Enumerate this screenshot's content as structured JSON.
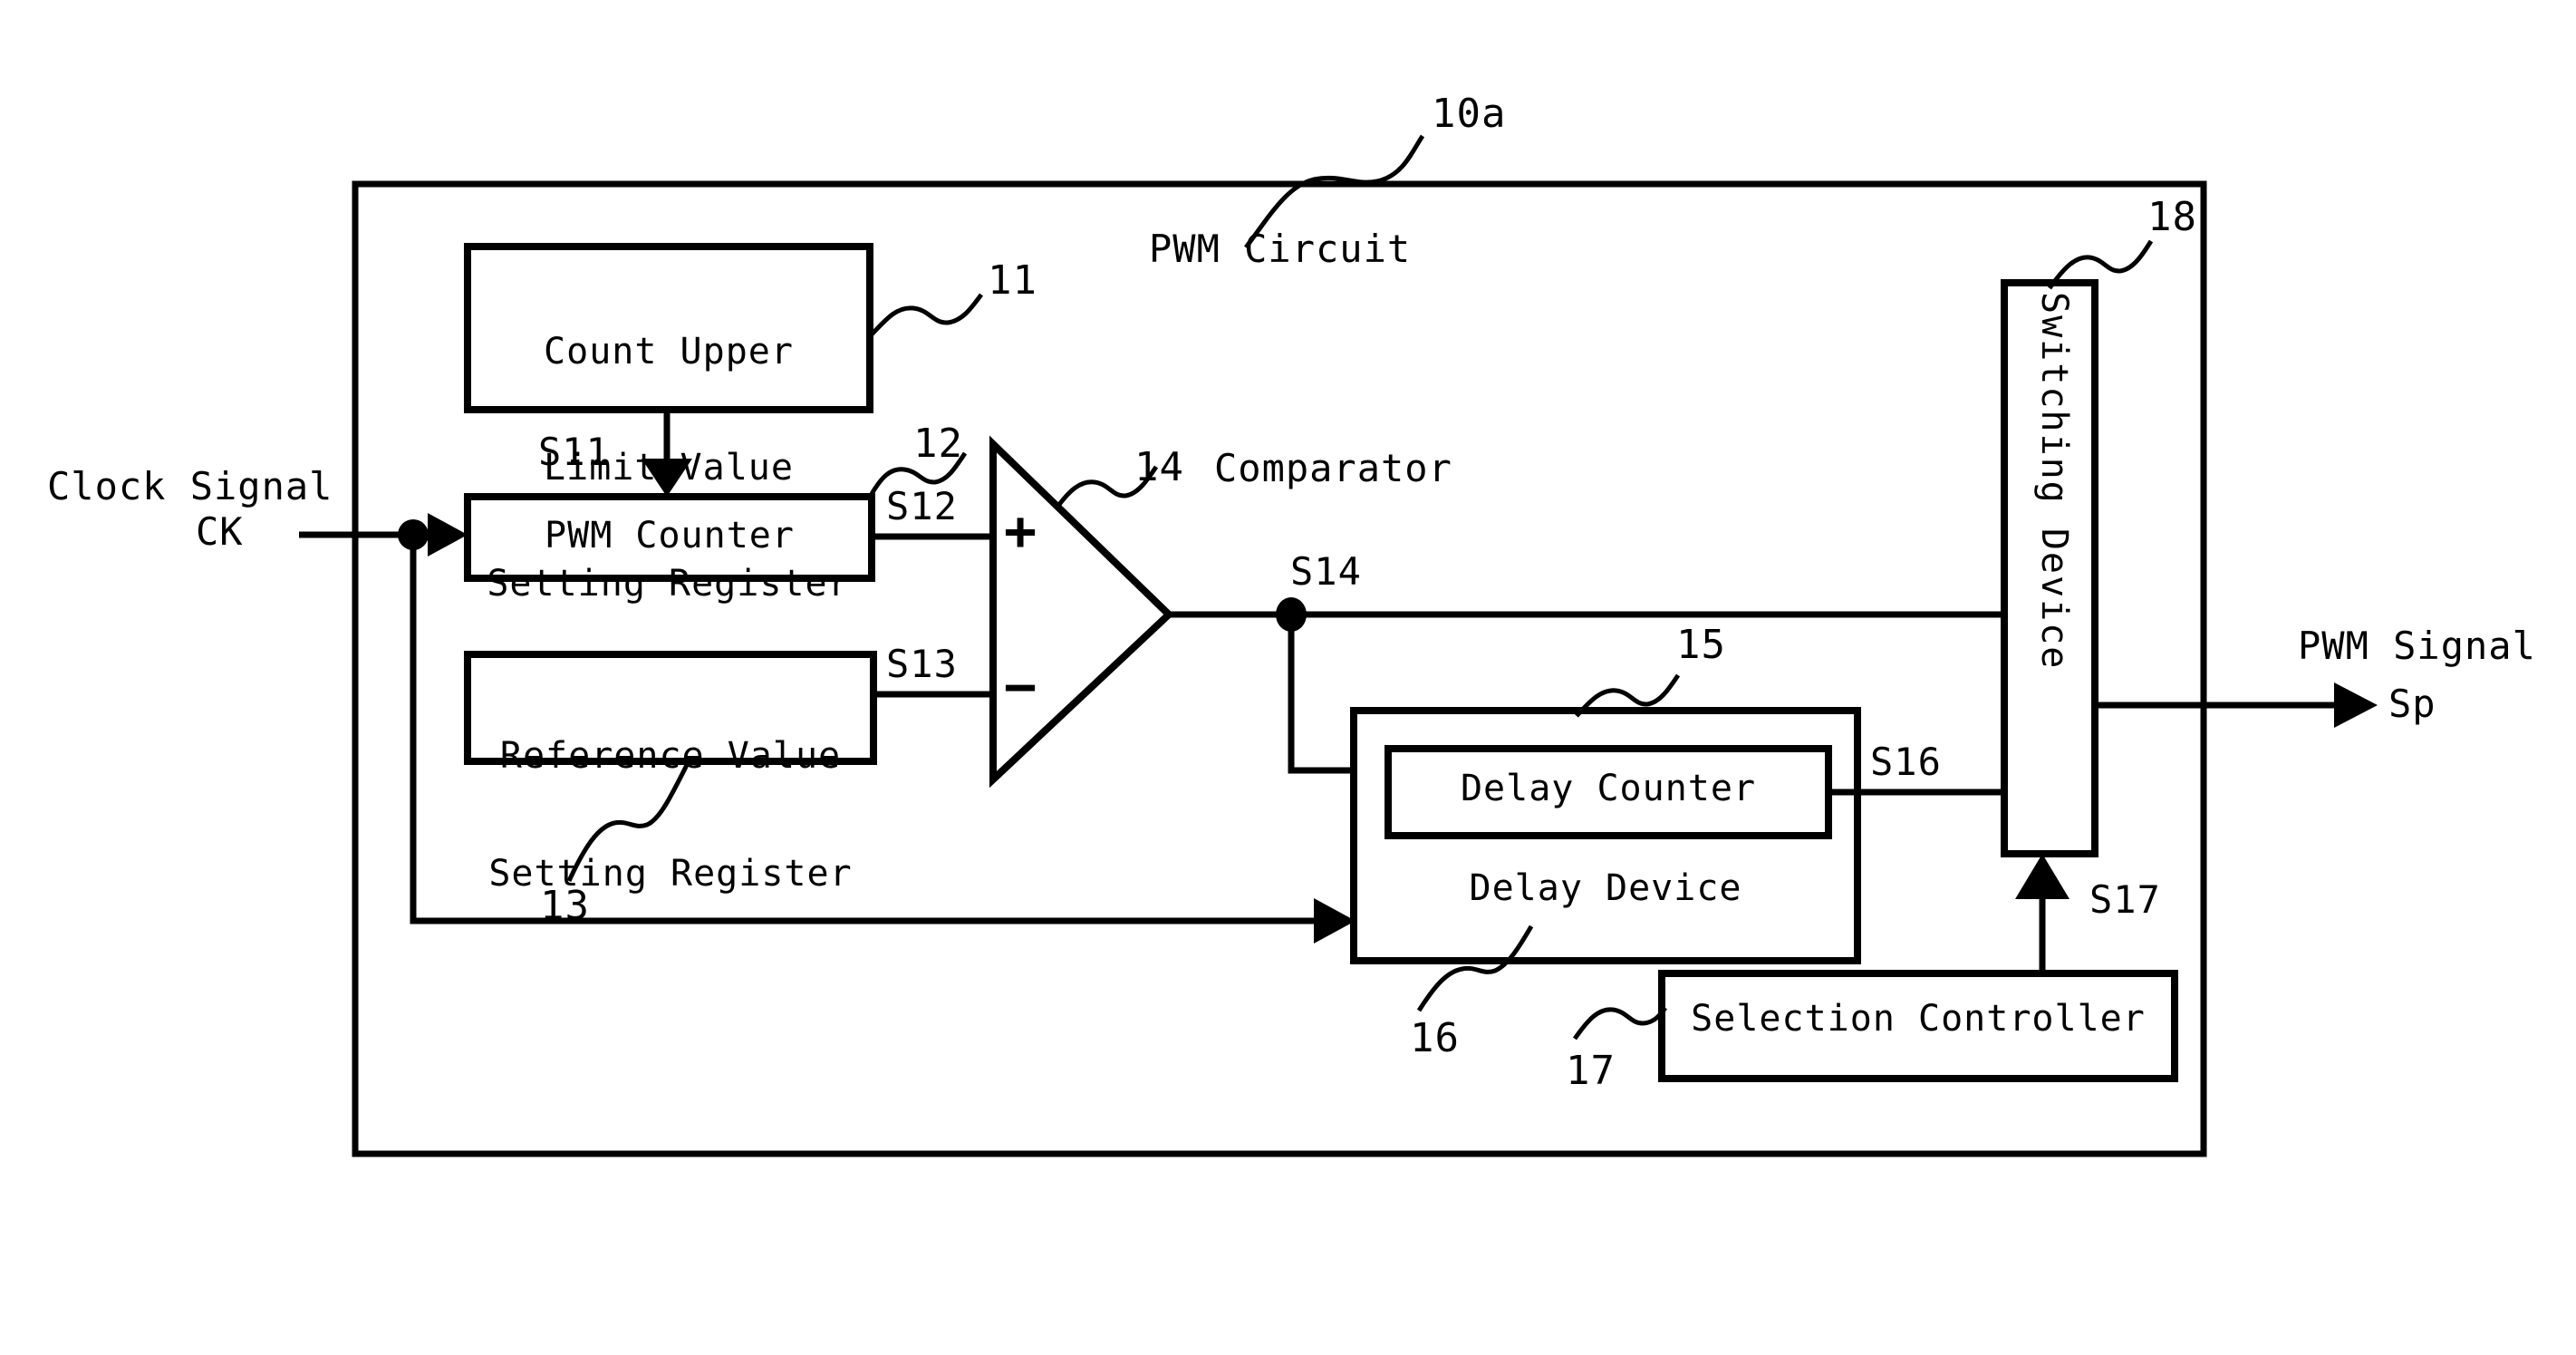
{
  "figure": {
    "type": "block-diagram",
    "domain": "patent-figure",
    "outer_block": {
      "label": "PWM Circuit",
      "reference_numeral": "10a"
    },
    "blocks": [
      {
        "id": "count-upper-limit-register",
        "label_lines": [
          "Count Upper",
          "Limit Value",
          "Setting Register"
        ],
        "label_flat": "Count Upper Limit Value Setting Register",
        "reference_numeral": "11"
      },
      {
        "id": "pwm-counter",
        "label_lines": [
          "PWM Counter"
        ],
        "label_flat": "PWM Counter",
        "reference_numeral": "12"
      },
      {
        "id": "reference-value-register",
        "label_lines": [
          "Reference Value",
          "Setting Register"
        ],
        "label_flat": "Reference Value Setting Register",
        "reference_numeral": "13"
      },
      {
        "id": "comparator",
        "label_lines": [
          "Comparator"
        ],
        "label_flat": "Comparator",
        "reference_numeral": "14",
        "input_plus": "+",
        "input_minus": "−"
      },
      {
        "id": "delay-counter",
        "label_lines": [
          "Delay Counter"
        ],
        "label_flat": "Delay Counter",
        "reference_numeral": "15"
      },
      {
        "id": "delay-device",
        "label_lines": [
          "Delay Device"
        ],
        "label_flat": "Delay Device",
        "reference_numeral": "16"
      },
      {
        "id": "selection-controller",
        "label_lines": [
          "Selection Controller"
        ],
        "label_flat": "Selection Controller",
        "reference_numeral": "17"
      },
      {
        "id": "switching-device",
        "label_lines": [
          "Switching Device"
        ],
        "label_flat": "Switching Device",
        "reference_numeral": "18",
        "orientation": "vertical"
      }
    ],
    "signals": [
      {
        "id": "s11",
        "label": "S11",
        "from": "count-upper-limit-register",
        "to": "pwm-counter"
      },
      {
        "id": "s12",
        "label": "S12",
        "from": "pwm-counter",
        "to": "comparator-plus"
      },
      {
        "id": "s13",
        "label": "S13",
        "from": "reference-value-register",
        "to": "comparator-minus"
      },
      {
        "id": "s14",
        "label": "S14",
        "from": "comparator",
        "to": "switching-device"
      },
      {
        "id": "s16",
        "label": "S16",
        "from": "delay-counter",
        "to": "switching-device"
      },
      {
        "id": "s17",
        "label": "S17",
        "from": "selection-controller",
        "to": "switching-device"
      }
    ],
    "ports": {
      "input": {
        "title": "Clock Signal",
        "symbol": "CK"
      },
      "output": {
        "title": "PWM Signal",
        "symbol": "Sp"
      }
    },
    "colors": {
      "ink": "#000000",
      "paper": "#ffffff"
    }
  }
}
